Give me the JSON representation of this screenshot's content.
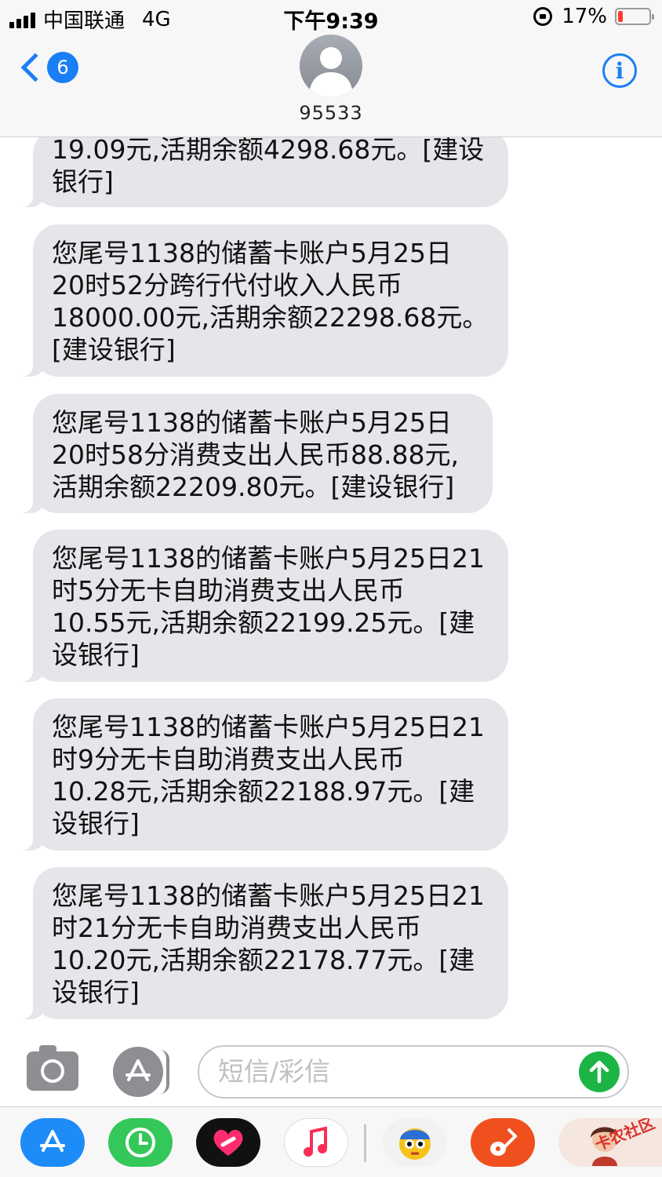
{
  "status_bar": {
    "carrier": "中国联通",
    "network": "4G",
    "time": "下午9:39",
    "battery_percent": "17%",
    "battery_level": 0.17
  },
  "nav": {
    "back_badge": "6",
    "contact": "95533",
    "info_label": "i"
  },
  "messages": [
    {
      "lines": [
        "19.09元,活期余额4298.68元。[建设",
        "银行]"
      ]
    },
    {
      "lines": [
        "您尾号1138的储蓄卡账户5月25日",
        "20时52分跨行代付收入人民币",
        "18000.00元,活期余额22298.68元。",
        "[建设银行]"
      ]
    },
    {
      "lines": [
        "您尾号1138的储蓄卡账户5月25日",
        "20时58分消费支出人民币88.88元,",
        "活期余额22209.80元。[建设银行]"
      ]
    },
    {
      "lines": [
        "您尾号1138的储蓄卡账户5月25日21",
        "时5分无卡自助消费支出人民币",
        "10.55元,活期余额22199.25元。[建",
        "设银行]"
      ]
    },
    {
      "lines": [
        "您尾号1138的储蓄卡账户5月25日21",
        "时9分无卡自助消费支出人民币",
        "10.28元,活期余额22188.97元。[建",
        "设银行]"
      ]
    },
    {
      "lines": [
        "您尾号1138的储蓄卡账户5月25日21",
        "时21分无卡自助消费支出人民币",
        "10.20元,活期余额22178.77元。[建",
        "设银行]"
      ]
    }
  ],
  "compose": {
    "placeholder": "短信/彩信"
  },
  "app_drawer": {
    "apps": [
      "app-store-icon",
      "clock-icon",
      "health-heart-icon",
      "music-icon",
      "emoji-character-icon",
      "guitar-icon",
      "avatar-sticker-icon"
    ],
    "watermark": "卡农社区"
  }
}
